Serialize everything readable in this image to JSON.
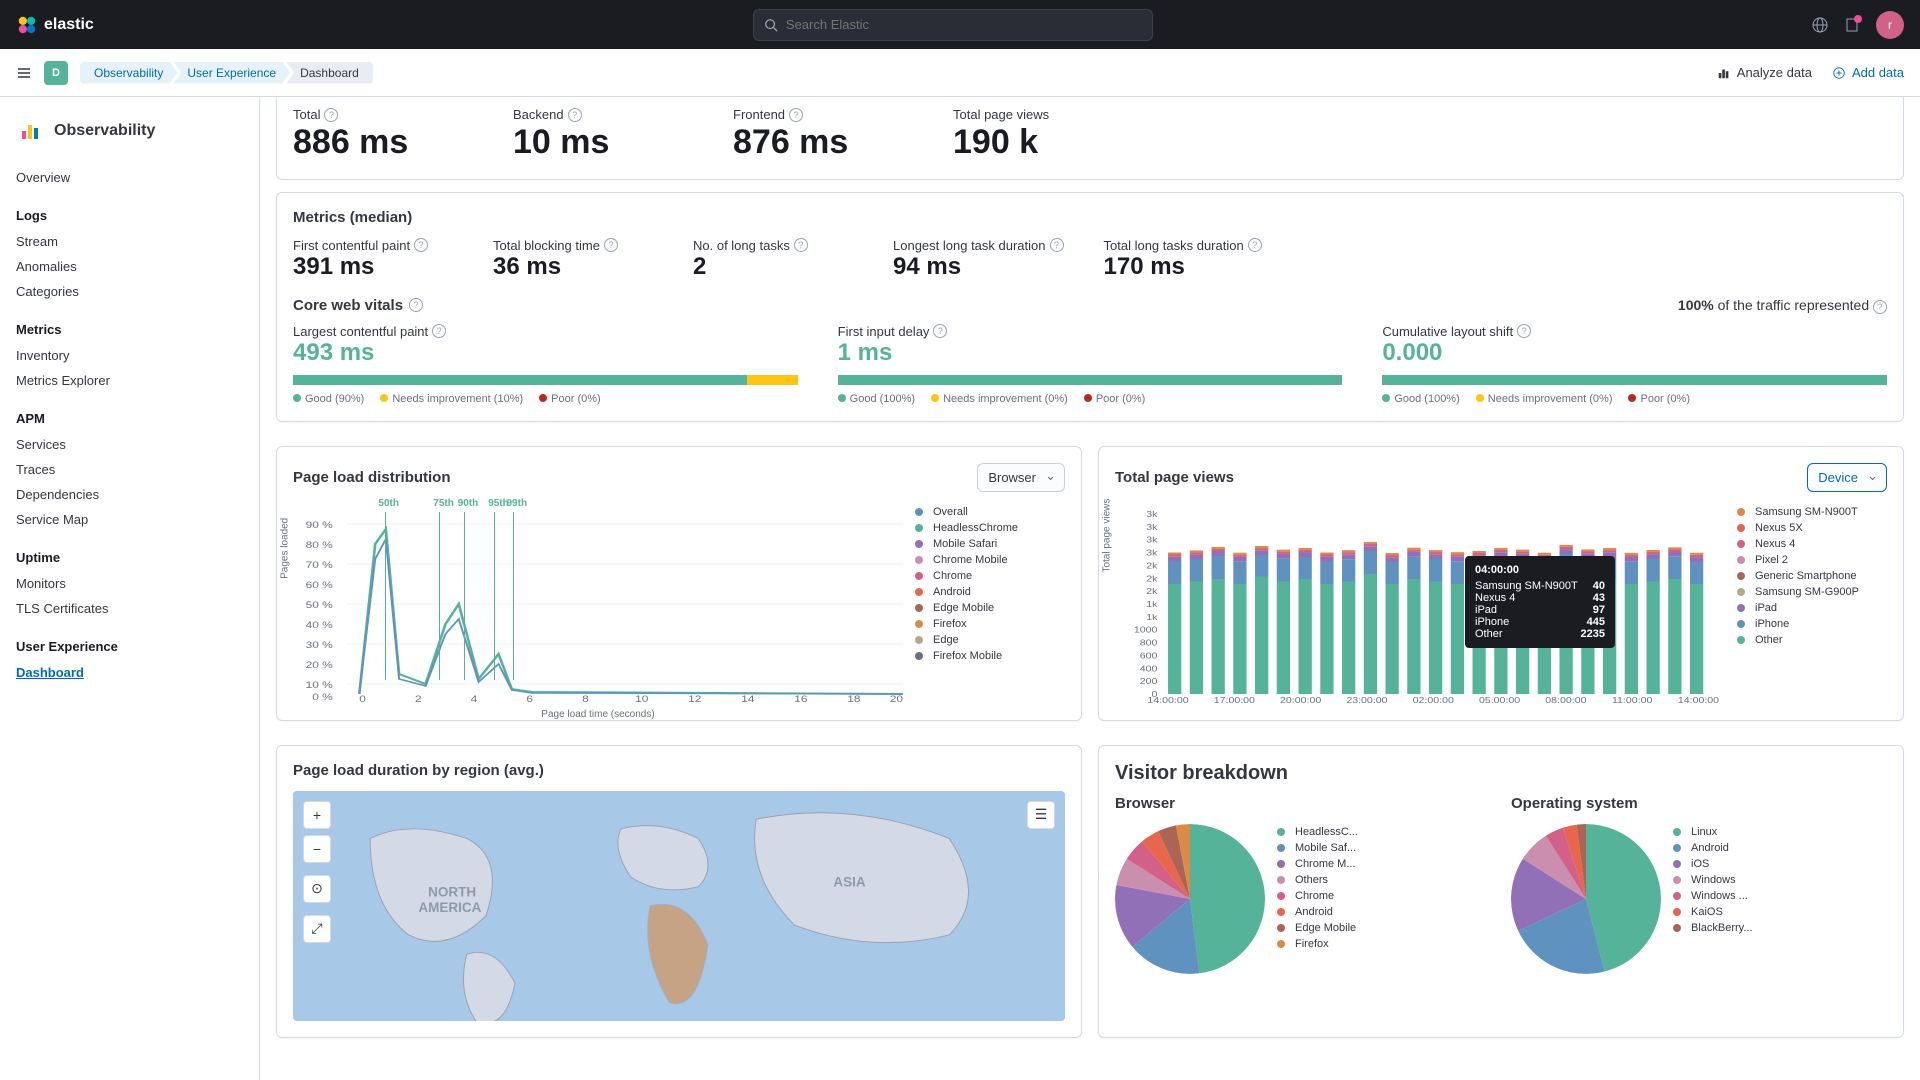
{
  "header": {
    "brand": "elastic",
    "search_placeholder": "Search Elastic",
    "avatar_initial": "r"
  },
  "subheader": {
    "app_badge": "D",
    "breadcrumbs": [
      "Observability",
      "User Experience",
      "Dashboard"
    ],
    "analyze": "Analyze data",
    "add_data": "Add data"
  },
  "sidebar": {
    "title": "Observability",
    "overview": "Overview",
    "sections": [
      {
        "title": "Logs",
        "items": [
          "Stream",
          "Anomalies",
          "Categories"
        ]
      },
      {
        "title": "Metrics",
        "items": [
          "Inventory",
          "Metrics Explorer"
        ]
      },
      {
        "title": "APM",
        "items": [
          "Services",
          "Traces",
          "Dependencies",
          "Service Map"
        ]
      },
      {
        "title": "Uptime",
        "items": [
          "Monitors",
          "TLS Certificates"
        ]
      },
      {
        "title": "User Experience",
        "items": [
          "Dashboard"
        ],
        "active": "Dashboard"
      }
    ]
  },
  "top_metrics": [
    {
      "label": "Total",
      "value": "886 ms"
    },
    {
      "label": "Backend",
      "value": "10 ms"
    },
    {
      "label": "Frontend",
      "value": "876 ms"
    },
    {
      "label": "Total page views",
      "value": "190 k"
    }
  ],
  "median": {
    "title": "Metrics (median)",
    "metrics": [
      {
        "label": "First contentful paint",
        "value": "391 ms"
      },
      {
        "label": "Total blocking time",
        "value": "36 ms"
      },
      {
        "label": "No. of long tasks",
        "value": "2"
      },
      {
        "label": "Longest long task duration",
        "value": "94 ms"
      },
      {
        "label": "Total long tasks duration",
        "value": "170 ms"
      }
    ]
  },
  "cwv": {
    "title": "Core web vitals",
    "traffic_pct": "100%",
    "traffic_label": " of the traffic represented",
    "metrics": [
      {
        "label": "Largest contentful paint",
        "value": "493 ms",
        "good": 90,
        "needs": 10,
        "poor": 0,
        "legend": [
          "Good (90%)",
          "Needs improvement (10%)",
          "Poor (0%)"
        ]
      },
      {
        "label": "First input delay",
        "value": "1 ms",
        "good": 100,
        "needs": 0,
        "poor": 0,
        "legend": [
          "Good (100%)",
          "Needs improvement (0%)",
          "Poor (0%)"
        ]
      },
      {
        "label": "Cumulative layout shift",
        "value": "0.000",
        "good": 100,
        "needs": 0,
        "poor": 0,
        "legend": [
          "Good (100%)",
          "Needs improvement (0%)",
          "Poor (0%)"
        ]
      }
    ]
  },
  "page_load_dist": {
    "title": "Page load distribution",
    "select_label": "Browser",
    "ylabel": "Pages loaded",
    "xlabel": "Page load time (seconds)",
    "percentiles": [
      "50th",
      "75th",
      "90th",
      "95th",
      "99th"
    ],
    "legend": [
      "Overall",
      "HeadlessChrome",
      "Mobile Safari",
      "Chrome Mobile",
      "Chrome",
      "Android",
      "Edge Mobile",
      "Firefox",
      "Edge",
      "Firefox Mobile"
    ],
    "legend_colors": [
      "#6092c0",
      "#54b399",
      "#9170b8",
      "#ca8eae",
      "#d36086",
      "#e7664c",
      "#aa6556",
      "#da8b45",
      "#b9a888",
      "#69707d"
    ]
  },
  "total_page_views": {
    "title": "Total page views",
    "select_label": "Device",
    "ylabel": "Total page views",
    "legend": [
      "Samsung SM-N900T",
      "Nexus 5X",
      "Nexus 4",
      "Pixel 2",
      "Generic Smartphone",
      "Samsung SM-G900P",
      "iPad",
      "iPhone",
      "Other"
    ],
    "legend_colors": [
      "#da8b45",
      "#e7664c",
      "#d36086",
      "#ca8eae",
      "#aa6556",
      "#b9a888",
      "#9170b8",
      "#6092c0",
      "#54b399"
    ],
    "x_ticks": [
      "14:00:00",
      "17:00:00",
      "20:00:00",
      "23:00:00",
      "02:00:00",
      "05:00:00",
      "08:00:00",
      "11:00:00",
      "14:00:00"
    ],
    "y_ticks": [
      "0",
      "200",
      "400",
      "600",
      "800",
      "1000",
      "1k",
      "1k",
      "2k",
      "2k",
      "2k",
      "3k",
      "3k",
      "3k",
      "3k"
    ],
    "tooltip": {
      "time": "04:00:00",
      "rows": [
        {
          "label": "Samsung SM-N900T",
          "value": "40"
        },
        {
          "label": "Nexus 4",
          "value": "43"
        },
        {
          "label": "iPad",
          "value": "97"
        },
        {
          "label": "iPhone",
          "value": "445"
        },
        {
          "label": "Other",
          "value": "2235"
        }
      ]
    }
  },
  "region": {
    "title": "Page load duration by region (avg.)",
    "labels": [
      "NORTH AMERICA",
      "ASIA"
    ]
  },
  "visitor": {
    "title": "Visitor breakdown",
    "browser": {
      "title": "Browser",
      "items": [
        "HeadlessC...",
        "Mobile Saf...",
        "Chrome M...",
        "Others",
        "Chrome",
        "Android",
        "Edge Mobile",
        "Firefox"
      ],
      "colors": [
        "#54b399",
        "#6092c0",
        "#9170b8",
        "#ca8eae",
        "#d36086",
        "#e7664c",
        "#aa6556",
        "#da8b45"
      ]
    },
    "os": {
      "title": "Operating system",
      "items": [
        "Linux",
        "Android",
        "iOS",
        "Windows",
        "Windows ...",
        "KaiOS",
        "BlackBerry..."
      ],
      "colors": [
        "#54b399",
        "#6092c0",
        "#9170b8",
        "#ca8eae",
        "#d36086",
        "#e7664c",
        "#aa6556"
      ]
    }
  },
  "chart_data": [
    {
      "type": "line",
      "name": "page_load_distribution",
      "xlabel": "Page load time (seconds)",
      "ylabel": "Pages loaded (%)",
      "x_range": [
        0,
        20
      ],
      "y_range": [
        0,
        90
      ],
      "percentile_markers_x": {
        "50th": 1.2,
        "75th": 2.6,
        "90th": 3.3,
        "95th": 4.4,
        "99th": 4.8
      },
      "series": [
        {
          "name": "Overall",
          "x": [
            0,
            1,
            1.2,
            2,
            3,
            3.5,
            4,
            5,
            6,
            20
          ],
          "y": [
            0,
            65,
            80,
            10,
            30,
            38,
            15,
            5,
            2,
            0
          ]
        },
        {
          "name": "HeadlessChrome",
          "x": [
            0,
            1,
            1.2,
            2,
            3,
            3.5,
            4,
            5,
            6,
            20
          ],
          "y": [
            0,
            70,
            85,
            8,
            28,
            35,
            12,
            3,
            1,
            0
          ]
        }
      ]
    },
    {
      "type": "bar",
      "name": "total_page_views",
      "xlabel": "time",
      "ylabel": "Total page views",
      "categories": [
        "14:00",
        "15:00",
        "16:00",
        "17:00",
        "18:00",
        "19:00",
        "20:00",
        "21:00",
        "22:00",
        "23:00",
        "00:00",
        "01:00",
        "02:00",
        "03:00",
        "04:00",
        "05:00",
        "06:00",
        "07:00",
        "08:00",
        "09:00",
        "10:00",
        "11:00",
        "12:00",
        "13:00",
        "14:00"
      ],
      "series": [
        {
          "name": "Other",
          "values": [
            2200,
            2250,
            2300,
            2200,
            2350,
            2250,
            2300,
            2200,
            2250,
            2400,
            2200,
            2300,
            2250,
            2200,
            2235,
            2300,
            2250,
            2200,
            2350,
            2250,
            2300,
            2200,
            2250,
            2300,
            2200
          ]
        },
        {
          "name": "iPhone",
          "values": [
            450,
            440,
            460,
            445,
            430,
            455,
            440,
            450,
            445,
            460,
            440,
            445,
            450,
            455,
            445,
            440,
            460,
            445,
            450,
            455,
            440,
            445,
            450,
            455,
            440
          ]
        },
        {
          "name": "iPad",
          "values": [
            95,
            98,
            100,
            97,
            95,
            96,
            99,
            97,
            98,
            95,
            96,
            97,
            95,
            98,
            97,
            96,
            95,
            97,
            98,
            99,
            95,
            96,
            97,
            95,
            98
          ]
        },
        {
          "name": "Nexus 4",
          "values": [
            45,
            43,
            42,
            44,
            43,
            45,
            42,
            43,
            44,
            45,
            43,
            42,
            44,
            43,
            43,
            45,
            42,
            43,
            44,
            45,
            43,
            42,
            44,
            43,
            45
          ]
        },
        {
          "name": "Samsung SM-N900T",
          "values": [
            40,
            41,
            39,
            40,
            42,
            41,
            40,
            39,
            40,
            41,
            40,
            42,
            39,
            40,
            40,
            41,
            40,
            39,
            40,
            42,
            41,
            40,
            39,
            40,
            41
          ]
        }
      ]
    },
    {
      "type": "pie",
      "name": "visitor_browser",
      "slices": [
        {
          "label": "HeadlessChrome",
          "value": 48
        },
        {
          "label": "Mobile Safari",
          "value": 16
        },
        {
          "label": "Chrome Mobile",
          "value": 14
        },
        {
          "label": "Others",
          "value": 6
        },
        {
          "label": "Chrome",
          "value": 5
        },
        {
          "label": "Android",
          "value": 4
        },
        {
          "label": "Edge Mobile",
          "value": 4
        },
        {
          "label": "Firefox",
          "value": 3
        }
      ]
    },
    {
      "type": "pie",
      "name": "visitor_os",
      "slices": [
        {
          "label": "Linux",
          "value": 46
        },
        {
          "label": "Android",
          "value": 22
        },
        {
          "label": "iOS",
          "value": 16
        },
        {
          "label": "Windows",
          "value": 7
        },
        {
          "label": "Windows ...",
          "value": 4
        },
        {
          "label": "KaiOS",
          "value": 3
        },
        {
          "label": "BlackBerry",
          "value": 2
        }
      ]
    }
  ]
}
